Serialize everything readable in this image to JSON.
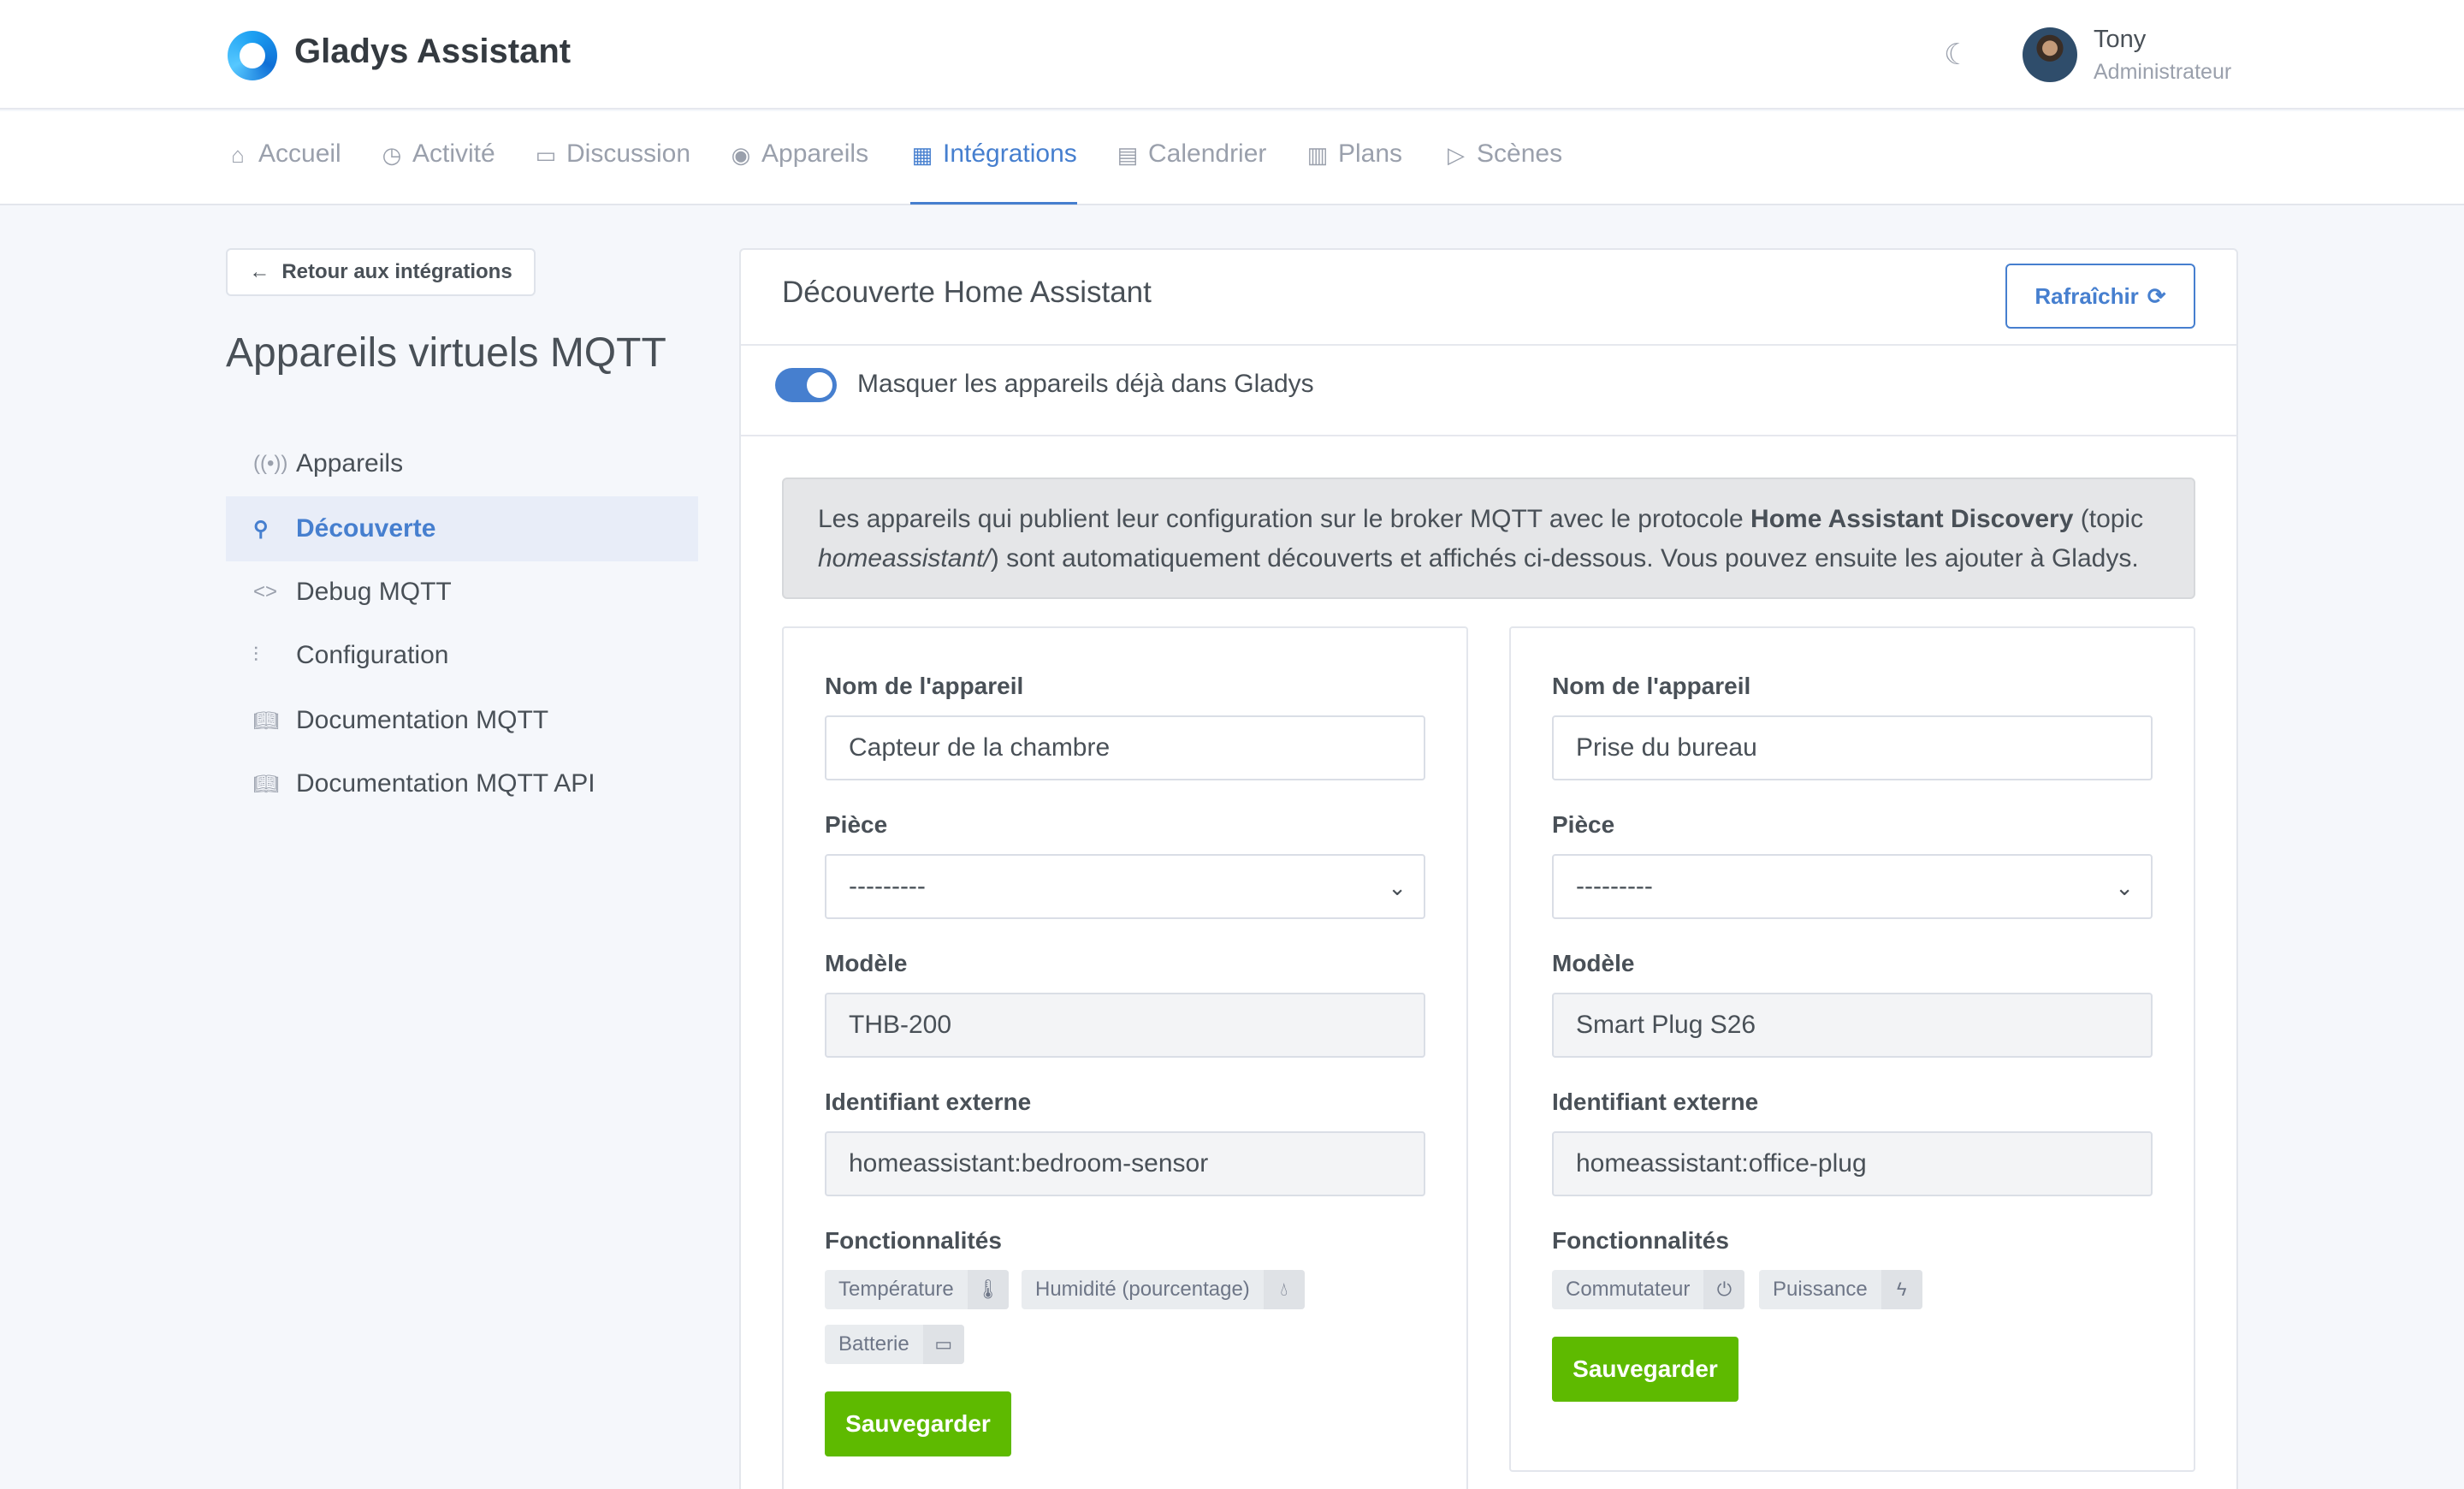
{
  "header": {
    "brand": "Gladys Assistant",
    "user_name": "Tony",
    "user_role": "Administrateur"
  },
  "nav": {
    "items": [
      {
        "label": "Accueil",
        "icon": "home-icon"
      },
      {
        "label": "Activité",
        "icon": "clock-icon"
      },
      {
        "label": "Discussion",
        "icon": "message-icon"
      },
      {
        "label": "Appareils",
        "icon": "toggle-icon"
      },
      {
        "label": "Intégrations",
        "icon": "grid-icon"
      },
      {
        "label": "Calendrier",
        "icon": "calendar-icon"
      },
      {
        "label": "Plans",
        "icon": "map-icon"
      },
      {
        "label": "Scènes",
        "icon": "play-icon"
      }
    ],
    "active": "Intégrations"
  },
  "sidebar": {
    "back_label": "Retour aux intégrations",
    "title": "Appareils virtuels MQTT",
    "items": [
      {
        "label": "Appareils",
        "icon": "radio-icon"
      },
      {
        "label": "Découverte",
        "icon": "search-icon"
      },
      {
        "label": "Debug MQTT",
        "icon": "code-icon"
      },
      {
        "label": "Configuration",
        "icon": "sliders-icon"
      },
      {
        "label": "Documentation MQTT",
        "icon": "book-icon"
      },
      {
        "label": "Documentation MQTT API",
        "icon": "book-icon"
      }
    ],
    "active": "Découverte"
  },
  "card": {
    "title": "Découverte Home Assistant",
    "refresh_label": "Rafraîchir",
    "toggle_label": "Masquer les appareils déjà dans Gladys",
    "toggle_on": true,
    "alert": {
      "part1": "Les appareils qui publient leur configuration sur le broker MQTT avec le protocole ",
      "bold": "Home Assistant Discovery",
      "part2": " (topic ",
      "italic": "homeassistant/",
      "part3": ") sont automatiquement découverts et affichés ci-dessous. Vous pouvez ensuite les ajouter à Gladys."
    }
  },
  "labels": {
    "name": "Nom de l'appareil",
    "room": "Pièce",
    "model": "Modèle",
    "external_id": "Identifiant externe",
    "features": "Fonctionnalités",
    "save": "Sauvegarder"
  },
  "devices": [
    {
      "name": "Capteur de la chambre",
      "room": "---------",
      "model": "THB-200",
      "external_id": "homeassistant:bedroom-sensor",
      "features": [
        {
          "label": "Température",
          "icon": "thermometer-icon"
        },
        {
          "label": "Humidité (pourcentage)",
          "icon": "droplet-icon"
        },
        {
          "label": "Batterie",
          "icon": "battery-icon"
        }
      ]
    },
    {
      "name": "Prise du bureau",
      "room": "---------",
      "model": "Smart Plug S26",
      "external_id": "homeassistant:office-plug",
      "features": [
        {
          "label": "Commutateur",
          "icon": "power-icon"
        },
        {
          "label": "Puissance",
          "icon": "zap-icon"
        }
      ]
    }
  ],
  "colors": {
    "primary": "#467fcf",
    "success": "#5eba00",
    "text": "#495057",
    "muted": "#9aa0ac",
    "background": "#f5f7fb"
  }
}
